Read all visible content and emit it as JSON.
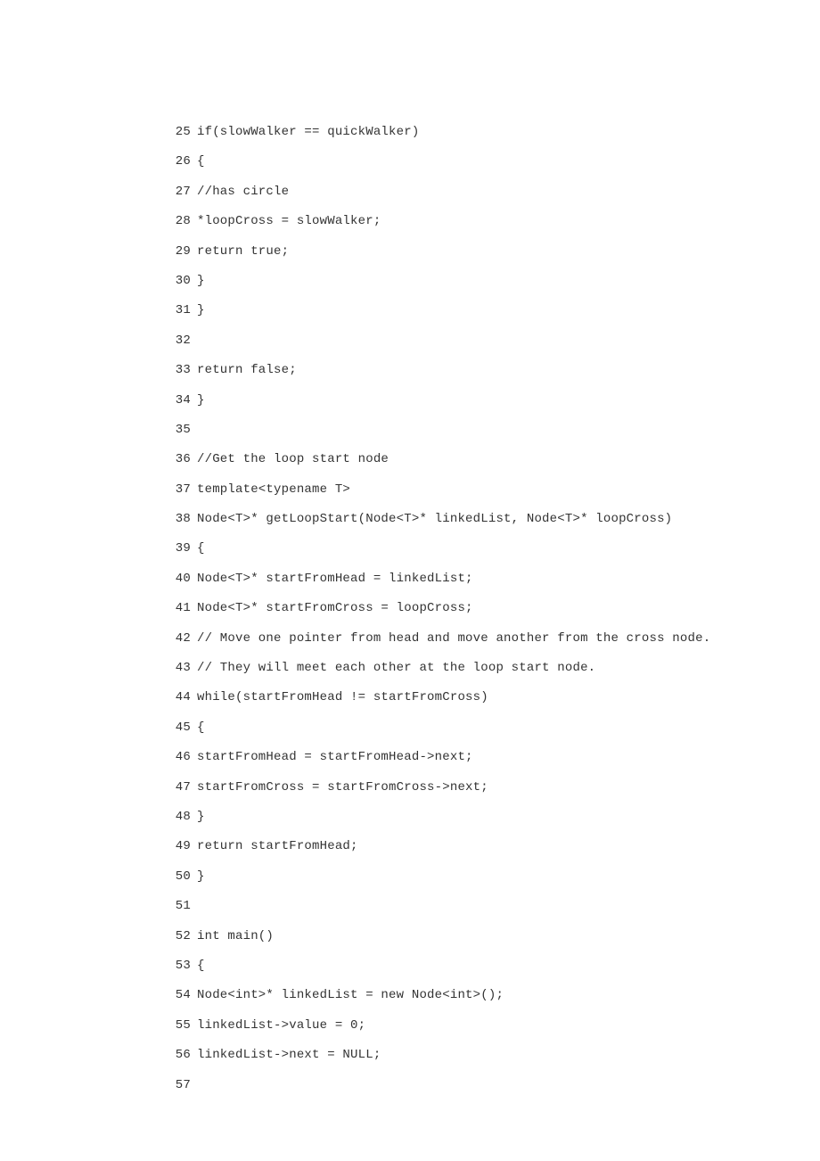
{
  "lines": [
    {
      "n": "25",
      "c": "if(slowWalker == quickWalker)"
    },
    {
      "n": "26",
      "c": "{"
    },
    {
      "n": "27",
      "c": "//has circle"
    },
    {
      "n": "28",
      "c": "*loopCross = slowWalker;"
    },
    {
      "n": "29",
      "c": "return true;"
    },
    {
      "n": "30",
      "c": "}"
    },
    {
      "n": "31",
      "c": "}"
    },
    {
      "n": "32",
      "c": ""
    },
    {
      "n": "33",
      "c": "return false;"
    },
    {
      "n": "34",
      "c": "}"
    },
    {
      "n": "35",
      "c": ""
    },
    {
      "n": "36",
      "c": "//Get the loop start node"
    },
    {
      "n": "37",
      "c": "template<typename T>"
    },
    {
      "n": "38",
      "c": "Node<T>* getLoopStart(Node<T>* linkedList, Node<T>* loopCross)"
    },
    {
      "n": "39",
      "c": "{"
    },
    {
      "n": "40",
      "c": "Node<T>* startFromHead = linkedList;"
    },
    {
      "n": "41",
      "c": "Node<T>* startFromCross = loopCross;"
    },
    {
      "n": "42",
      "c": "// Move one pointer from head and move another from the cross node."
    },
    {
      "n": "43",
      "c": "// They will meet each other at the loop start node."
    },
    {
      "n": "44",
      "c": "while(startFromHead != startFromCross)"
    },
    {
      "n": "45",
      "c": "{"
    },
    {
      "n": "46",
      "c": "startFromHead = startFromHead->next;"
    },
    {
      "n": "47",
      "c": "startFromCross = startFromCross->next;"
    },
    {
      "n": "48",
      "c": "}"
    },
    {
      "n": "49",
      "c": "return startFromHead;"
    },
    {
      "n": "50",
      "c": "}"
    },
    {
      "n": "51",
      "c": ""
    },
    {
      "n": "52",
      "c": "int main()"
    },
    {
      "n": "53",
      "c": "{"
    },
    {
      "n": "54",
      "c": "Node<int>* linkedList = new Node<int>();"
    },
    {
      "n": "55",
      "c": "linkedList->value = 0;"
    },
    {
      "n": "56",
      "c": "linkedList->next = NULL;"
    },
    {
      "n": "57",
      "c": ""
    }
  ]
}
